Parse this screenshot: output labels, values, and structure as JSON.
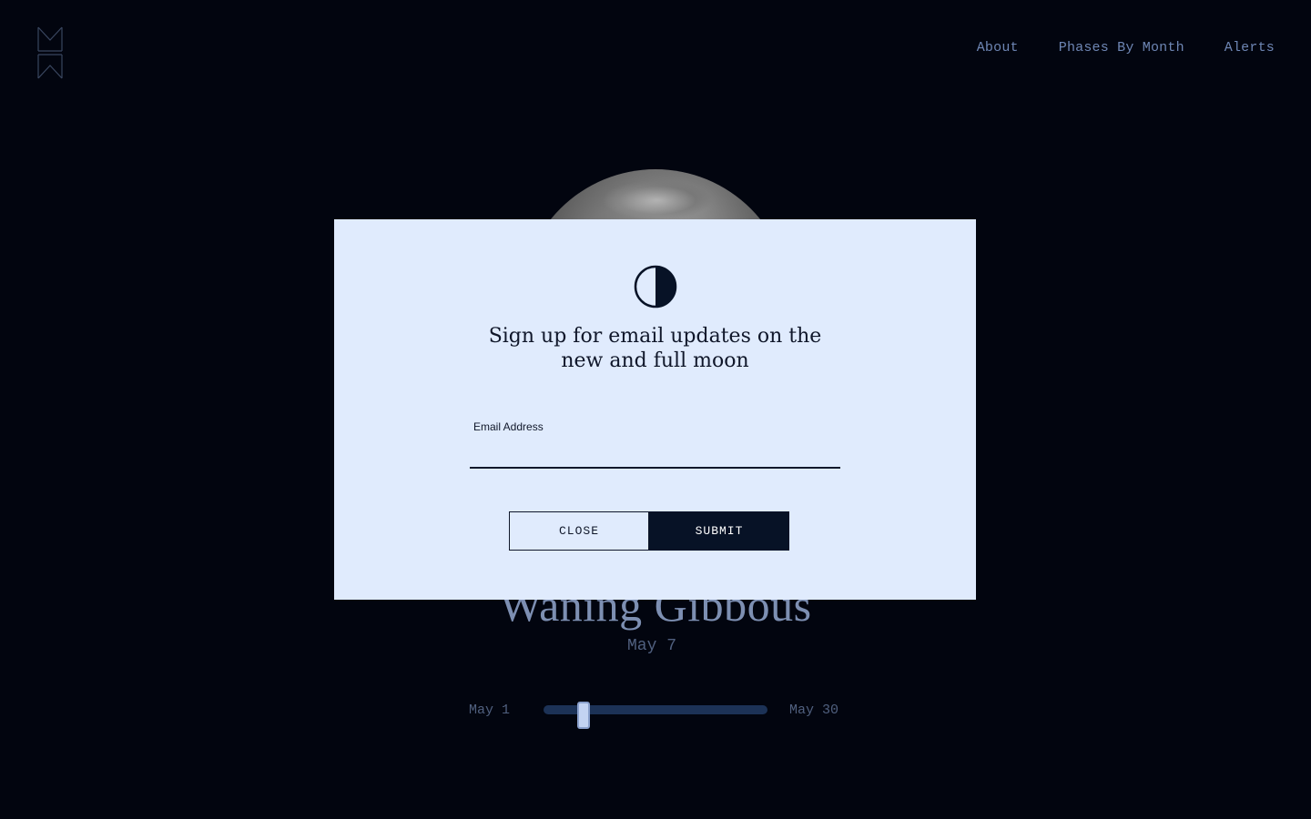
{
  "header": {
    "logo_icon": "moon-monogram-logo",
    "nav": [
      {
        "label": "About"
      },
      {
        "label": "Phases By Month"
      },
      {
        "label": "Alerts"
      }
    ]
  },
  "phase": {
    "name": "Waning Gibbous",
    "date": "May 7"
  },
  "slider": {
    "start_label": "May 1",
    "end_label": "May 30",
    "value_fraction": 0.18
  },
  "modal": {
    "icon": "half-moon-icon",
    "title": "Sign up for email updates on the new and full moon",
    "email_label": "Email Address",
    "email_value": "",
    "email_placeholder": "",
    "close_label": "CLOSE",
    "submit_label": "SUBMIT"
  },
  "colors": {
    "background": "#02050f",
    "nav_text": "#6e86b4",
    "modal_bg": "#e0ebfd",
    "dark_ink": "#10172a",
    "submit_bg": "#071226",
    "slider_track": "#1c3256",
    "slider_thumb": "#c3d3f2"
  }
}
